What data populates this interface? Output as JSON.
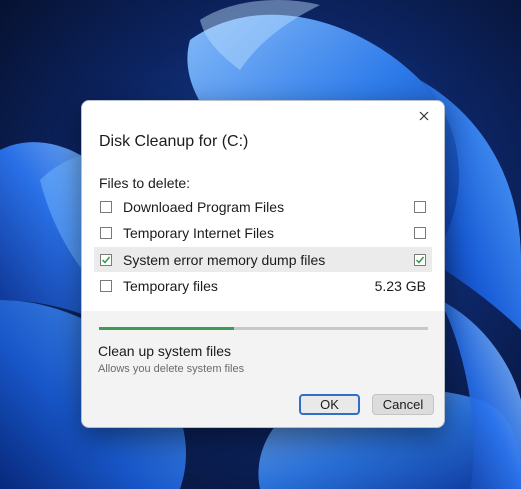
{
  "dialog": {
    "title": "Disk Cleanup for (C:)",
    "section_label": "Files to delete:",
    "items": [
      {
        "label": "Downloaed Program Files",
        "left_checked": false,
        "right_checked": false,
        "size": ""
      },
      {
        "label": "Temporary Internet Files",
        "left_checked": false,
        "right_checked": false,
        "size": ""
      },
      {
        "label": "System error memory dump files",
        "left_checked": true,
        "right_checked": true,
        "size": "",
        "highlighted": true
      },
      {
        "label": "Temporary files",
        "left_checked": false,
        "size": "5.23 GB"
      }
    ],
    "progress": {
      "fraction": 0.41,
      "color": "#3d9c53"
    },
    "cleanup": {
      "title": "Clean up system files",
      "description": "Allows you delete system files"
    },
    "buttons": {
      "ok": "OK",
      "cancel": "Cancel"
    }
  },
  "colors": {
    "accent": "#2f6fcc",
    "check": "#2e9b46",
    "wallpaper": "#0a1a3d"
  },
  "icons": {
    "close": "close-icon",
    "check": "checkmark-icon"
  }
}
